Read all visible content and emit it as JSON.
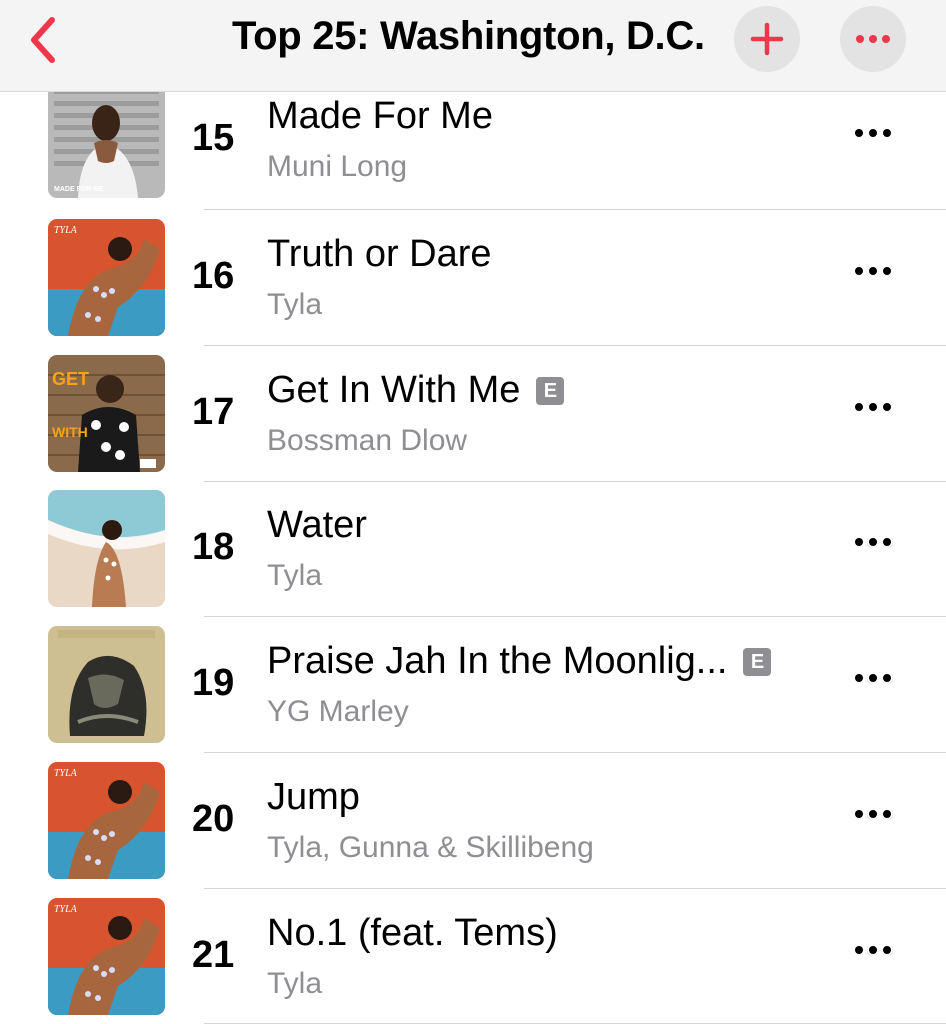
{
  "header": {
    "title": "Top 25: Washington, D.C.",
    "back_icon": "chevron-left-icon",
    "add_icon": "plus-icon",
    "more_icon": "ellipsis-icon",
    "accent_color": "#f0364b"
  },
  "tracks": [
    {
      "rank": "15",
      "title": "Made For Me",
      "artist": "Muni Long",
      "explicit": false,
      "art_label": "MADE FOR ME"
    },
    {
      "rank": "16",
      "title": "Truth or Dare",
      "artist": "Tyla",
      "explicit": false,
      "art_label": "TYLA"
    },
    {
      "rank": "17",
      "title": "Get In With Me",
      "artist": "Bossman Dlow",
      "explicit": true,
      "explicit_label": "E"
    },
    {
      "rank": "18",
      "title": "Water",
      "artist": "Tyla",
      "explicit": false
    },
    {
      "rank": "19",
      "title": "Praise Jah In the Moonlig...",
      "artist": "YG Marley",
      "explicit": true,
      "explicit_label": "E"
    },
    {
      "rank": "20",
      "title": "Jump",
      "artist": "Tyla, Gunna & Skillibeng",
      "explicit": false,
      "art_label": "TYLA"
    },
    {
      "rank": "21",
      "title": "No.1 (feat. Tems)",
      "artist": "Tyla",
      "explicit": false,
      "art_label": "TYLA"
    }
  ]
}
